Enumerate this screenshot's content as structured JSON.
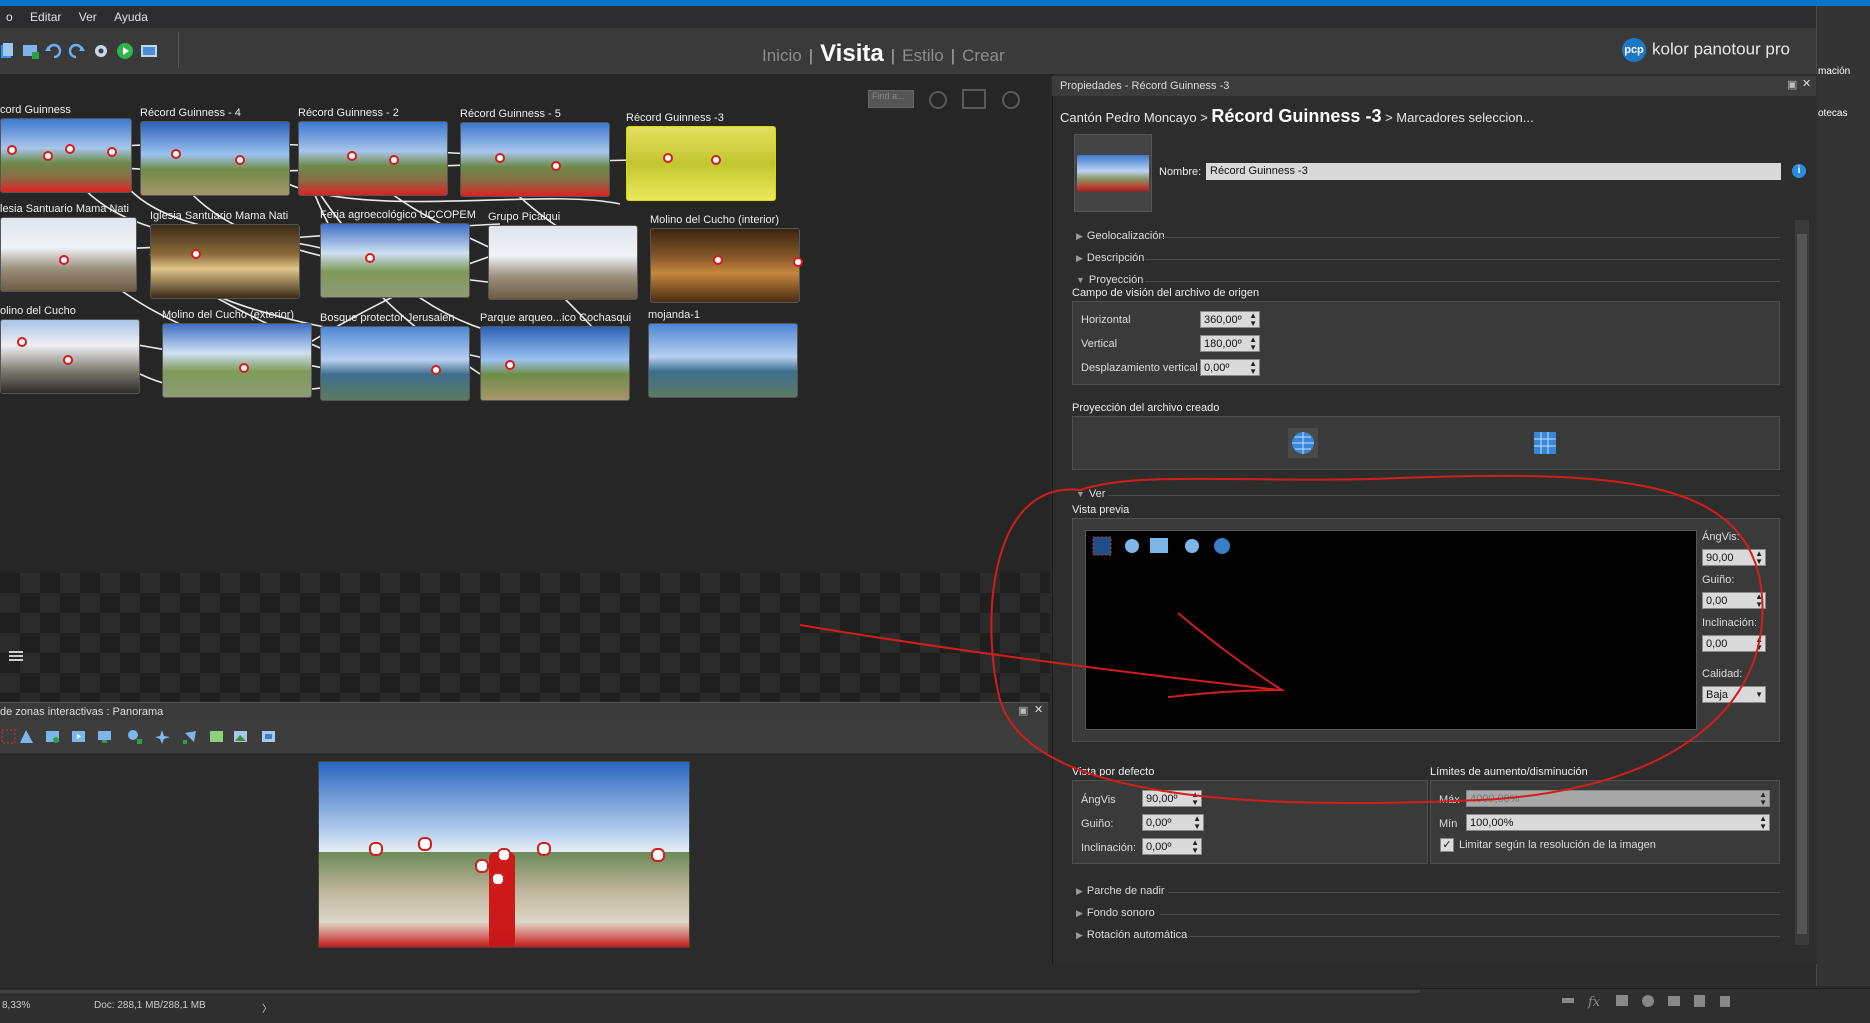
{
  "menu": {
    "items": [
      "o",
      "Editar",
      "Ver",
      "Ayuda"
    ]
  },
  "toolbar": {
    "icons": [
      "new-project-icon",
      "add-panorama-icon",
      "undo-icon",
      "redo-icon",
      "settings-icon",
      "play-icon",
      "publish-icon"
    ],
    "modes": [
      "Inicio",
      "Visita",
      "Estilo",
      "Crear"
    ],
    "active_mode": "Visita"
  },
  "brand": {
    "logo": "pcp",
    "name": "kolor panotour pro"
  },
  "canvas": {
    "zoom_placeholder": "Find a...",
    "panoramas": [
      {
        "label": "cord Guinness"
      },
      {
        "label": "Récord Guinness - 4"
      },
      {
        "label": "Récord Guinness - 2"
      },
      {
        "label": "Récord Guinness - 5"
      },
      {
        "label": "Récord Guinness -3"
      },
      {
        "label": "lesia Santuario Mama Nati"
      },
      {
        "label": "Iglesia Santuario Mama Nati"
      },
      {
        "label": "Feria agroecológico UCCOPEM"
      },
      {
        "label": "Grupo Picalqui"
      },
      {
        "label": "Molino del Cucho (interior)"
      },
      {
        "label": "olino del Cucho"
      },
      {
        "label": "Molino del Cucho (exterior)"
      },
      {
        "label": "Bosque protector Jerusalén"
      },
      {
        "label": "Parque arqueo...ico Cochasqui"
      },
      {
        "label": "mojanda-1"
      }
    ]
  },
  "hotspot_panel": {
    "title": "de zonas interactivas : Panorama",
    "tools": [
      "select-icon",
      "arrow-hotspot-icon",
      "photo-hotspot-icon",
      "video-hotspot-icon",
      "text-hotspot-icon",
      "zoom-hotspot-icon",
      "add-point-icon",
      "add-polygon-icon",
      "rect-icon",
      "image-icon",
      "link-icon"
    ]
  },
  "properties": {
    "title": "Propiedades - Récord Guinness -3",
    "breadcrumb": {
      "root": "Cantón Pedro Moncayo > ",
      "current": "Récord Guinness -3",
      "tail": " > Marcadores seleccion..."
    },
    "name_label": "Nombre:",
    "name_value": "Récord Guinness -3",
    "sections": {
      "geolocalizacion": "Geolocalización",
      "descripcion": "Descripción",
      "proyeccion": "Proyección",
      "ver": "Ver",
      "parche": "Parche de nadir",
      "fondo": "Fondo sonoro",
      "rotacion": "Rotación automática"
    },
    "source_fov": {
      "title": "Campo de visión del archivo de origen",
      "horizontal_label": "Horizontal",
      "horizontal_value": "360,00º",
      "vertical_label": "Vertical",
      "vertical_value": "180,00º",
      "offset_label": "Desplazamiento vertical",
      "offset_value": "0,00º"
    },
    "output_projection": {
      "title": "Proyección del archivo creado",
      "options": [
        "sphere-icon",
        "cube-icon"
      ]
    },
    "preview": {
      "title": "Vista previa",
      "tools": [
        "frame-icon",
        "hotspot-view-icon",
        "image-view-icon",
        "pin-icon",
        "compass-icon"
      ],
      "angvis_label": "ÁngVis:",
      "angvis_value": "90,00",
      "guino_label": "Guiño:",
      "guino_value": "0,00",
      "inclinacion_label": "Inclinación:",
      "inclinacion_value": "0,00",
      "calidad_label": "Calidad:",
      "calidad_value": "Baja"
    },
    "default_view": {
      "title": "Vista por defecto",
      "angvis_label": "ÁngVis",
      "angvis_value": "90,00º",
      "guino_label": "Guiño:",
      "guino_value": "0,00º",
      "inclinacion_label": "Inclinación:",
      "inclinacion_value": "0,00º"
    },
    "zoom_limits": {
      "title": "Límites de aumento/disminución",
      "max_label": "Máx",
      "max_value": "4000,00%",
      "min_label": "Mín",
      "min_value": "100,00%",
      "limit_label": "Limitar según la resolución de la imagen",
      "limit_checked": true
    }
  },
  "status": {
    "zoom": "8,33%",
    "doc": "Doc: 288,1 MB/288,1 MB"
  },
  "right_strip": {
    "items": [
      "mación",
      "otecas"
    ]
  },
  "annotation_color": "#d31d1d"
}
